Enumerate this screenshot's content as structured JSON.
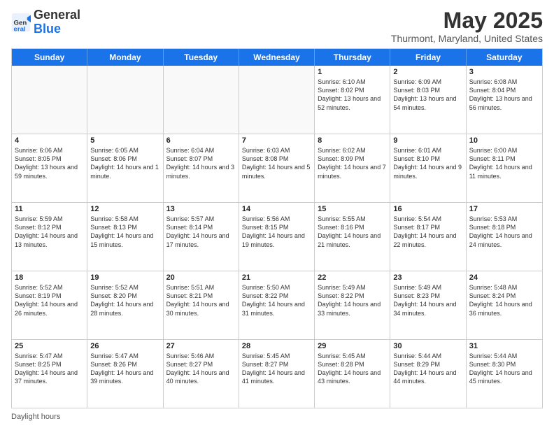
{
  "logo": {
    "general": "General",
    "blue": "Blue"
  },
  "header": {
    "title": "May 2025",
    "subtitle": "Thurmont, Maryland, United States"
  },
  "days": [
    "Sunday",
    "Monday",
    "Tuesday",
    "Wednesday",
    "Thursday",
    "Friday",
    "Saturday"
  ],
  "footer": "Daylight hours",
  "weeks": [
    [
      {
        "day": "",
        "content": ""
      },
      {
        "day": "",
        "content": ""
      },
      {
        "day": "",
        "content": ""
      },
      {
        "day": "",
        "content": ""
      },
      {
        "day": "1",
        "content": "Sunrise: 6:10 AM\nSunset: 8:02 PM\nDaylight: 13 hours and 52 minutes."
      },
      {
        "day": "2",
        "content": "Sunrise: 6:09 AM\nSunset: 8:03 PM\nDaylight: 13 hours and 54 minutes."
      },
      {
        "day": "3",
        "content": "Sunrise: 6:08 AM\nSunset: 8:04 PM\nDaylight: 13 hours and 56 minutes."
      }
    ],
    [
      {
        "day": "4",
        "content": "Sunrise: 6:06 AM\nSunset: 8:05 PM\nDaylight: 13 hours and 59 minutes."
      },
      {
        "day": "5",
        "content": "Sunrise: 6:05 AM\nSunset: 8:06 PM\nDaylight: 14 hours and 1 minute."
      },
      {
        "day": "6",
        "content": "Sunrise: 6:04 AM\nSunset: 8:07 PM\nDaylight: 14 hours and 3 minutes."
      },
      {
        "day": "7",
        "content": "Sunrise: 6:03 AM\nSunset: 8:08 PM\nDaylight: 14 hours and 5 minutes."
      },
      {
        "day": "8",
        "content": "Sunrise: 6:02 AM\nSunset: 8:09 PM\nDaylight: 14 hours and 7 minutes."
      },
      {
        "day": "9",
        "content": "Sunrise: 6:01 AM\nSunset: 8:10 PM\nDaylight: 14 hours and 9 minutes."
      },
      {
        "day": "10",
        "content": "Sunrise: 6:00 AM\nSunset: 8:11 PM\nDaylight: 14 hours and 11 minutes."
      }
    ],
    [
      {
        "day": "11",
        "content": "Sunrise: 5:59 AM\nSunset: 8:12 PM\nDaylight: 14 hours and 13 minutes."
      },
      {
        "day": "12",
        "content": "Sunrise: 5:58 AM\nSunset: 8:13 PM\nDaylight: 14 hours and 15 minutes."
      },
      {
        "day": "13",
        "content": "Sunrise: 5:57 AM\nSunset: 8:14 PM\nDaylight: 14 hours and 17 minutes."
      },
      {
        "day": "14",
        "content": "Sunrise: 5:56 AM\nSunset: 8:15 PM\nDaylight: 14 hours and 19 minutes."
      },
      {
        "day": "15",
        "content": "Sunrise: 5:55 AM\nSunset: 8:16 PM\nDaylight: 14 hours and 21 minutes."
      },
      {
        "day": "16",
        "content": "Sunrise: 5:54 AM\nSunset: 8:17 PM\nDaylight: 14 hours and 22 minutes."
      },
      {
        "day": "17",
        "content": "Sunrise: 5:53 AM\nSunset: 8:18 PM\nDaylight: 14 hours and 24 minutes."
      }
    ],
    [
      {
        "day": "18",
        "content": "Sunrise: 5:52 AM\nSunset: 8:19 PM\nDaylight: 14 hours and 26 minutes."
      },
      {
        "day": "19",
        "content": "Sunrise: 5:52 AM\nSunset: 8:20 PM\nDaylight: 14 hours and 28 minutes."
      },
      {
        "day": "20",
        "content": "Sunrise: 5:51 AM\nSunset: 8:21 PM\nDaylight: 14 hours and 30 minutes."
      },
      {
        "day": "21",
        "content": "Sunrise: 5:50 AM\nSunset: 8:22 PM\nDaylight: 14 hours and 31 minutes."
      },
      {
        "day": "22",
        "content": "Sunrise: 5:49 AM\nSunset: 8:22 PM\nDaylight: 14 hours and 33 minutes."
      },
      {
        "day": "23",
        "content": "Sunrise: 5:49 AM\nSunset: 8:23 PM\nDaylight: 14 hours and 34 minutes."
      },
      {
        "day": "24",
        "content": "Sunrise: 5:48 AM\nSunset: 8:24 PM\nDaylight: 14 hours and 36 minutes."
      }
    ],
    [
      {
        "day": "25",
        "content": "Sunrise: 5:47 AM\nSunset: 8:25 PM\nDaylight: 14 hours and 37 minutes."
      },
      {
        "day": "26",
        "content": "Sunrise: 5:47 AM\nSunset: 8:26 PM\nDaylight: 14 hours and 39 minutes."
      },
      {
        "day": "27",
        "content": "Sunrise: 5:46 AM\nSunset: 8:27 PM\nDaylight: 14 hours and 40 minutes."
      },
      {
        "day": "28",
        "content": "Sunrise: 5:45 AM\nSunset: 8:27 PM\nDaylight: 14 hours and 41 minutes."
      },
      {
        "day": "29",
        "content": "Sunrise: 5:45 AM\nSunset: 8:28 PM\nDaylight: 14 hours and 43 minutes."
      },
      {
        "day": "30",
        "content": "Sunrise: 5:44 AM\nSunset: 8:29 PM\nDaylight: 14 hours and 44 minutes."
      },
      {
        "day": "31",
        "content": "Sunrise: 5:44 AM\nSunset: 8:30 PM\nDaylight: 14 hours and 45 minutes."
      }
    ]
  ]
}
